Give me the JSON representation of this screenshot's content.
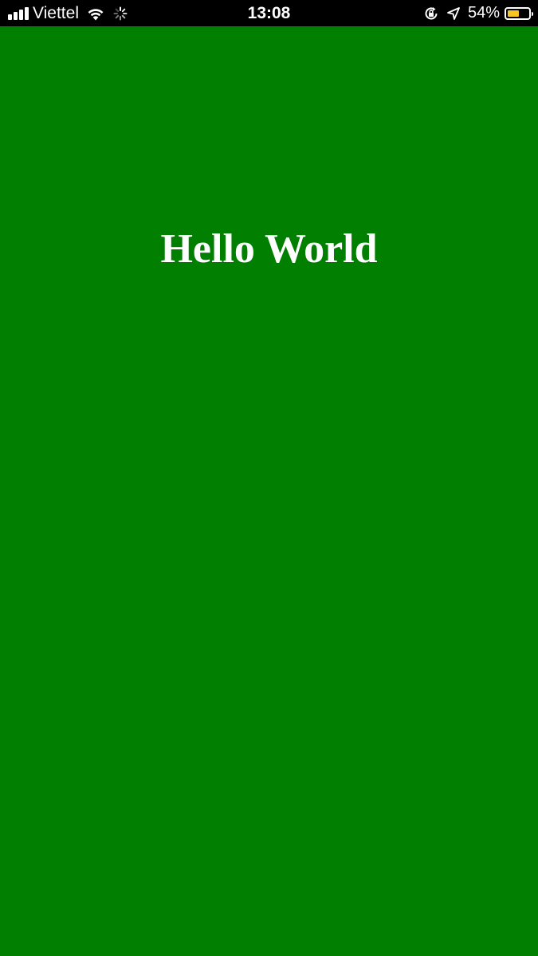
{
  "status_bar": {
    "carrier": "Viettel",
    "time": "13:08",
    "battery_percent_text": "54%",
    "battery_level": 0.54,
    "icons": [
      "signal-icon",
      "wifi-icon",
      "activity-spinner-icon",
      "rotation-lock-icon",
      "location-icon",
      "battery-icon"
    ],
    "battery_color": "#f6c525"
  },
  "main": {
    "heading": "Hello World",
    "background_color": "#007f00",
    "text_color": "#ffffff"
  }
}
